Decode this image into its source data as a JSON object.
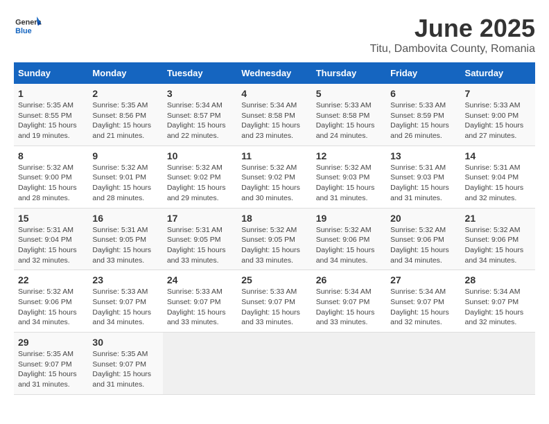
{
  "header": {
    "logo_general": "General",
    "logo_blue": "Blue",
    "title": "June 2025",
    "subtitle": "Titu, Dambovita County, Romania"
  },
  "calendar": {
    "weekdays": [
      "Sunday",
      "Monday",
      "Tuesday",
      "Wednesday",
      "Thursday",
      "Friday",
      "Saturday"
    ],
    "weeks": [
      [
        null,
        null,
        null,
        null,
        null,
        null,
        null
      ]
    ],
    "days": {
      "1": {
        "sunrise": "5:35 AM",
        "sunset": "8:55 PM",
        "daylight": "15 hours and 19 minutes."
      },
      "2": {
        "sunrise": "5:35 AM",
        "sunset": "8:56 PM",
        "daylight": "15 hours and 21 minutes."
      },
      "3": {
        "sunrise": "5:34 AM",
        "sunset": "8:57 PM",
        "daylight": "15 hours and 22 minutes."
      },
      "4": {
        "sunrise": "5:34 AM",
        "sunset": "8:58 PM",
        "daylight": "15 hours and 23 minutes."
      },
      "5": {
        "sunrise": "5:33 AM",
        "sunset": "8:58 PM",
        "daylight": "15 hours and 24 minutes."
      },
      "6": {
        "sunrise": "5:33 AM",
        "sunset": "8:59 PM",
        "daylight": "15 hours and 26 minutes."
      },
      "7": {
        "sunrise": "5:33 AM",
        "sunset": "9:00 PM",
        "daylight": "15 hours and 27 minutes."
      },
      "8": {
        "sunrise": "5:32 AM",
        "sunset": "9:00 PM",
        "daylight": "15 hours and 28 minutes."
      },
      "9": {
        "sunrise": "5:32 AM",
        "sunset": "9:01 PM",
        "daylight": "15 hours and 28 minutes."
      },
      "10": {
        "sunrise": "5:32 AM",
        "sunset": "9:02 PM",
        "daylight": "15 hours and 29 minutes."
      },
      "11": {
        "sunrise": "5:32 AM",
        "sunset": "9:02 PM",
        "daylight": "15 hours and 30 minutes."
      },
      "12": {
        "sunrise": "5:32 AM",
        "sunset": "9:03 PM",
        "daylight": "15 hours and 31 minutes."
      },
      "13": {
        "sunrise": "5:31 AM",
        "sunset": "9:03 PM",
        "daylight": "15 hours and 31 minutes."
      },
      "14": {
        "sunrise": "5:31 AM",
        "sunset": "9:04 PM",
        "daylight": "15 hours and 32 minutes."
      },
      "15": {
        "sunrise": "5:31 AM",
        "sunset": "9:04 PM",
        "daylight": "15 hours and 32 minutes."
      },
      "16": {
        "sunrise": "5:31 AM",
        "sunset": "9:05 PM",
        "daylight": "15 hours and 33 minutes."
      },
      "17": {
        "sunrise": "5:31 AM",
        "sunset": "9:05 PM",
        "daylight": "15 hours and 33 minutes."
      },
      "18": {
        "sunrise": "5:32 AM",
        "sunset": "9:05 PM",
        "daylight": "15 hours and 33 minutes."
      },
      "19": {
        "sunrise": "5:32 AM",
        "sunset": "9:06 PM",
        "daylight": "15 hours and 34 minutes."
      },
      "20": {
        "sunrise": "5:32 AM",
        "sunset": "9:06 PM",
        "daylight": "15 hours and 34 minutes."
      },
      "21": {
        "sunrise": "5:32 AM",
        "sunset": "9:06 PM",
        "daylight": "15 hours and 34 minutes."
      },
      "22": {
        "sunrise": "5:32 AM",
        "sunset": "9:06 PM",
        "daylight": "15 hours and 34 minutes."
      },
      "23": {
        "sunrise": "5:33 AM",
        "sunset": "9:07 PM",
        "daylight": "15 hours and 34 minutes."
      },
      "24": {
        "sunrise": "5:33 AM",
        "sunset": "9:07 PM",
        "daylight": "15 hours and 33 minutes."
      },
      "25": {
        "sunrise": "5:33 AM",
        "sunset": "9:07 PM",
        "daylight": "15 hours and 33 minutes."
      },
      "26": {
        "sunrise": "5:34 AM",
        "sunset": "9:07 PM",
        "daylight": "15 hours and 33 minutes."
      },
      "27": {
        "sunrise": "5:34 AM",
        "sunset": "9:07 PM",
        "daylight": "15 hours and 32 minutes."
      },
      "28": {
        "sunrise": "5:34 AM",
        "sunset": "9:07 PM",
        "daylight": "15 hours and 32 minutes."
      },
      "29": {
        "sunrise": "5:35 AM",
        "sunset": "9:07 PM",
        "daylight": "15 hours and 31 minutes."
      },
      "30": {
        "sunrise": "5:35 AM",
        "sunset": "9:07 PM",
        "daylight": "15 hours and 31 minutes."
      }
    }
  }
}
